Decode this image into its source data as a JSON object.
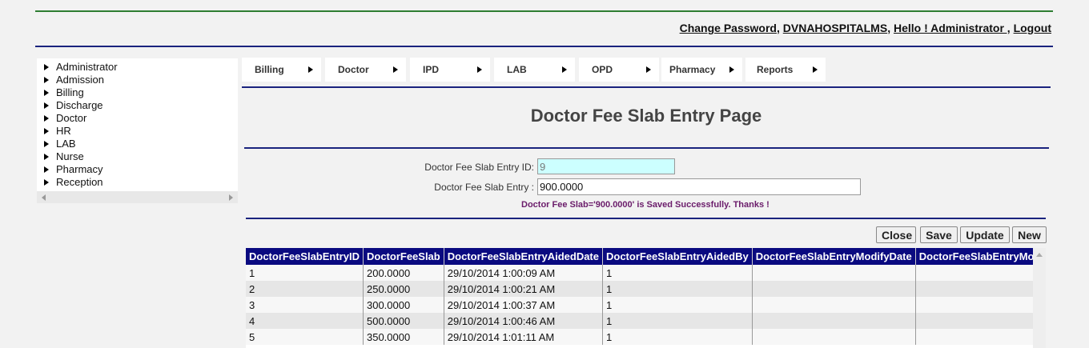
{
  "header": {
    "change_password": "Change Password",
    "sep1": ",",
    "hospital": "DVNAHOSPITALMS",
    "sep2": ",",
    "greeting": "Hello ! Administrator ,",
    "logout": "Logout"
  },
  "sidebar": {
    "items": [
      {
        "label": "Administrator"
      },
      {
        "label": "Admission"
      },
      {
        "label": "Billing"
      },
      {
        "label": "Discharge"
      },
      {
        "label": "Doctor"
      },
      {
        "label": "HR"
      },
      {
        "label": "LAB"
      },
      {
        "label": "Nurse"
      },
      {
        "label": "Pharmacy"
      },
      {
        "label": "Reception"
      }
    ]
  },
  "menu": {
    "items": [
      {
        "label": "Billing"
      },
      {
        "label": "Doctor"
      },
      {
        "label": "IPD"
      },
      {
        "label": "LAB"
      },
      {
        "label": "OPD"
      },
      {
        "label": "Pharmacy"
      },
      {
        "label": "Reports"
      }
    ]
  },
  "page": {
    "title": "Doctor Fee Slab Entry Page"
  },
  "form": {
    "id_label": "Doctor Fee Slab Entry ID:",
    "id_value": "9",
    "slab_label": "Doctor Fee Slab Entry :",
    "slab_value": "900.0000",
    "message": "Doctor Fee Slab='900.0000' is Saved Successfully. Thanks !"
  },
  "buttons": {
    "close": "Close",
    "save": "Save",
    "update": "Update",
    "new": "New"
  },
  "grid": {
    "columns": [
      "DoctorFeeSlabEntryID",
      "DoctorFeeSlab",
      "DoctorFeeSlabEntryAidedDate",
      "DoctorFeeSlabEntryAidedBy",
      "DoctorFeeSlabEntryModifyDate",
      "DoctorFeeSlabEntryModifiedBy"
    ],
    "rows": [
      [
        "1",
        "200.0000",
        "29/10/2014 1:00:09 AM",
        "1",
        "",
        ""
      ],
      [
        "2",
        "250.0000",
        "29/10/2014 1:00:21 AM",
        "1",
        "",
        ""
      ],
      [
        "3",
        "300.0000",
        "29/10/2014 1:00:37 AM",
        "1",
        "",
        ""
      ],
      [
        "4",
        "500.0000",
        "29/10/2014 1:00:46 AM",
        "1",
        "",
        ""
      ],
      [
        "5",
        "350.0000",
        "29/10/2014 1:01:11 AM",
        "1",
        "",
        ""
      ]
    ]
  },
  "colors": {
    "grid_header": "#0a0a80",
    "rule": "#1a237e",
    "top_rule": "#2e7d32",
    "id_field": "#ccffff",
    "message": "#6a1b6a"
  }
}
